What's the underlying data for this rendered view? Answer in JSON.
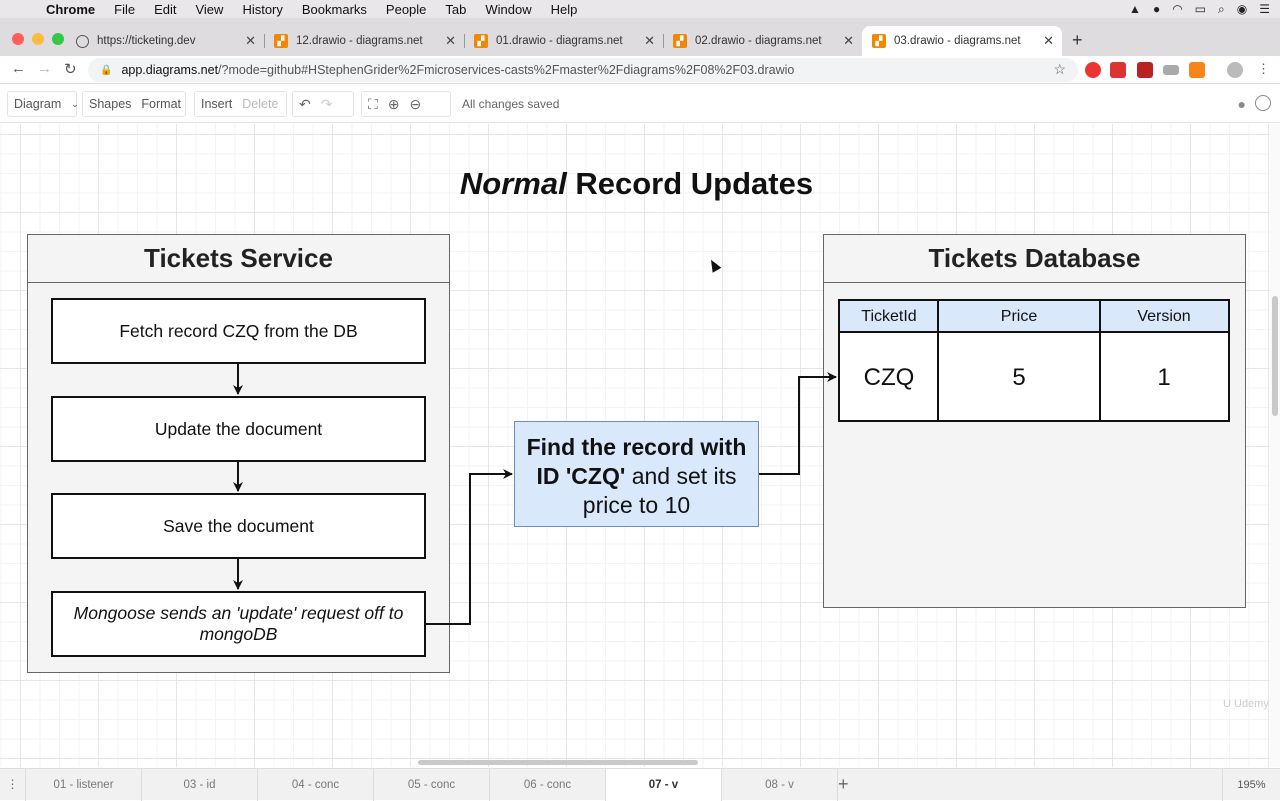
{
  "menubar": {
    "app": "Chrome",
    "items": [
      "File",
      "Edit",
      "View",
      "History",
      "Bookmarks",
      "People",
      "Tab",
      "Window",
      "Help"
    ]
  },
  "tabs": [
    {
      "title": "https://ticketing.dev",
      "icon": "globe-icon"
    },
    {
      "title": "12.drawio - diagrams.net",
      "icon": "drawio-icon"
    },
    {
      "title": "01.drawio - diagrams.net",
      "icon": "drawio-icon"
    },
    {
      "title": "02.drawio - diagrams.net",
      "icon": "drawio-icon"
    },
    {
      "title": "03.drawio - diagrams.net",
      "icon": "drawio-icon",
      "active": true
    }
  ],
  "address": {
    "host": "app.diagrams.net",
    "path": "/?mode=github#HStephenGrider%2Fmicroservices-casts%2Fmaster%2Fdiagrams%2F08%2F03.drawio"
  },
  "toolbar": {
    "diagram": "Diagram",
    "shapes": "Shapes",
    "format": "Format",
    "insert": "Insert",
    "delete": "Delete",
    "status": "All changes saved"
  },
  "diagram": {
    "title_italic": "Normal",
    "title_rest": "Record Updates",
    "service_panel": {
      "title": "Tickets Service",
      "steps": [
        "Fetch record CZQ from the DB",
        "Update the document",
        "Save the document",
        "Mongoose sends an 'update' request off to mongoDB"
      ]
    },
    "request_box": {
      "bold": "Find the record with ID 'CZQ'",
      "rest": "and set its price to 10"
    },
    "database_panel": {
      "title": "Tickets Database",
      "columns": [
        "TicketId",
        "Price",
        "Version"
      ],
      "row": [
        "CZQ",
        "5",
        "1"
      ]
    }
  },
  "pages": [
    "01 - listener",
    "03 - id",
    "04 - conc",
    "05 - conc",
    "06 - conc",
    "07 - v",
    "08 - v"
  ],
  "active_page": "07 - v",
  "zoom": "195%",
  "colors": {
    "request_fill": "#dae8fc",
    "request_stroke": "#6c8ebf",
    "panel_fill": "#f4f4f4",
    "drawio_orange": "#f08705"
  }
}
